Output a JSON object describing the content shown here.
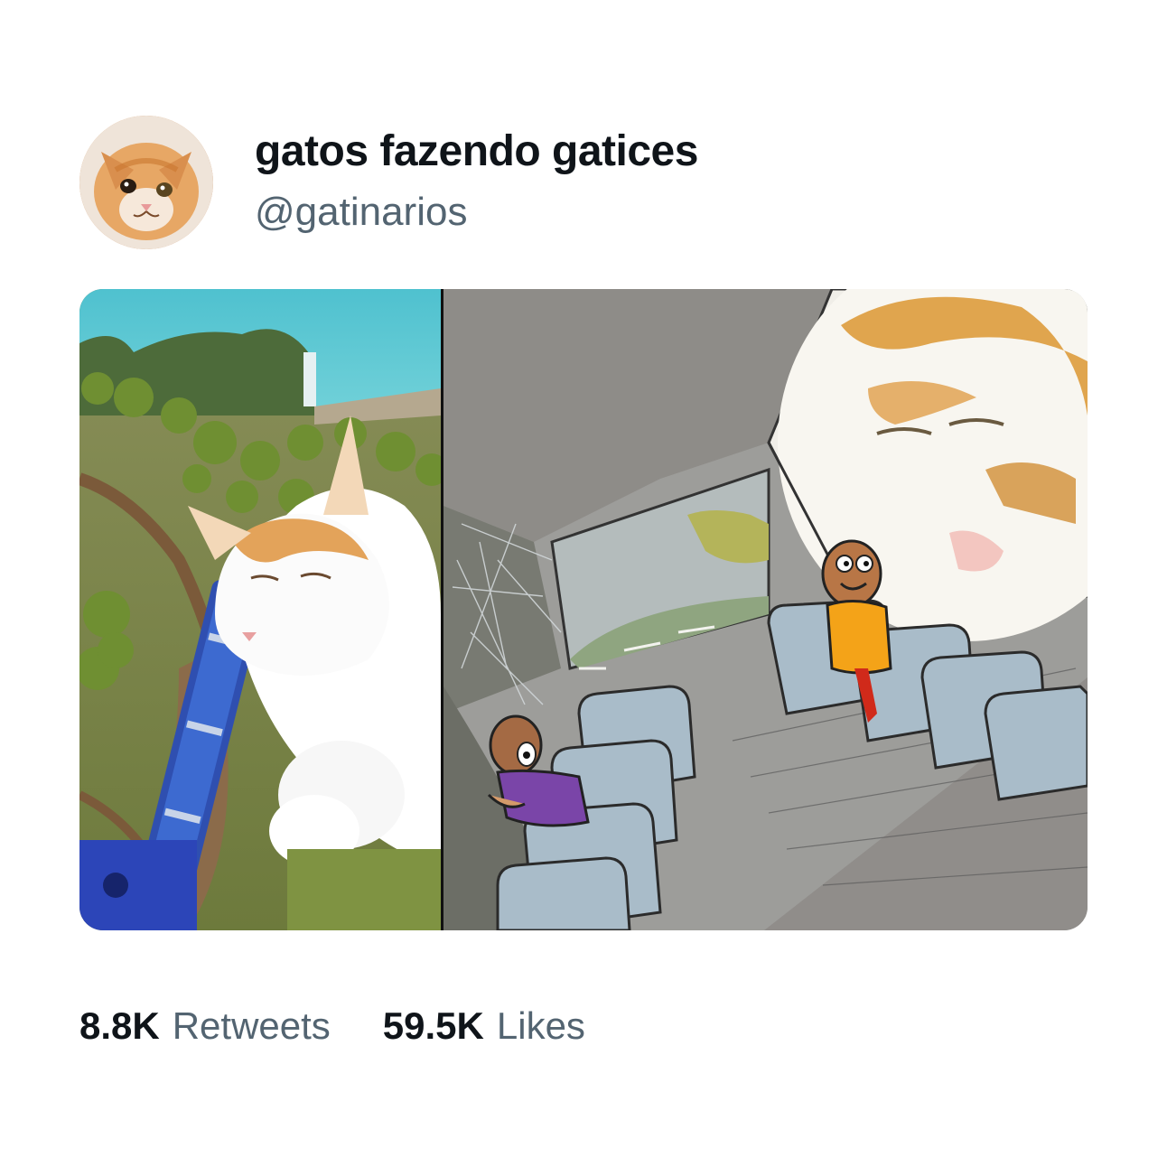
{
  "tweet": {
    "author": {
      "display_name": "gatos fazendo gatices",
      "handle": "@gatinarios",
      "avatar_icon": "orange-cat-avatar"
    },
    "media": {
      "left_panel": "cat-sleeping-on-model-train",
      "right_panel": "two-guys-on-a-bus-meme-with-giant-sleeping-cat"
    },
    "stats": {
      "retweets_value": "8.8K",
      "retweets_label": "Retweets",
      "likes_value": "59.5K",
      "likes_label": "Likes"
    }
  },
  "colors": {
    "background": "#ffffff",
    "text_primary": "#0f1419",
    "text_secondary": "#536471"
  }
}
